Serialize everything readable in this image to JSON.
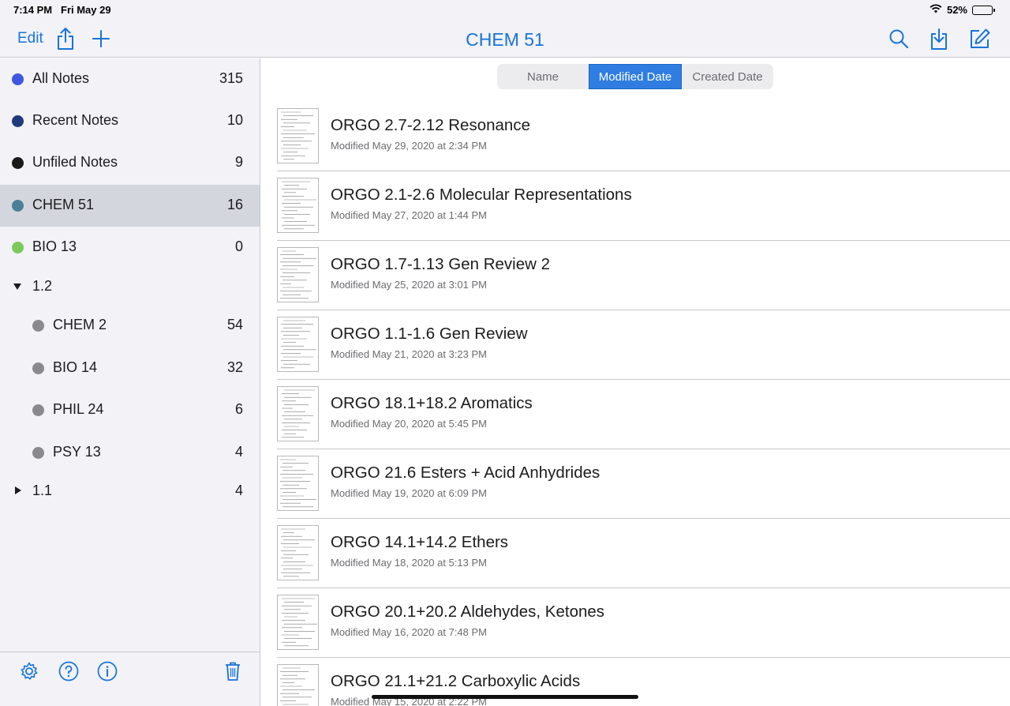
{
  "status": {
    "time": "7:14 PM",
    "date": "Fri May 29",
    "battery_pct": "52%",
    "battery_level": 0.52
  },
  "nav": {
    "edit_label": "Edit",
    "title": "CHEM 51"
  },
  "sidebar": {
    "items": [
      {
        "label": "All Notes",
        "count": "315",
        "color": "#3f56e0"
      },
      {
        "label": "Recent Notes",
        "count": "10",
        "color": "#1f3a7a"
      },
      {
        "label": "Unfiled Notes",
        "count": "9",
        "color": "#1a1a1a"
      },
      {
        "label": "CHEM 51",
        "count": "16",
        "color": "#4a7f95",
        "selected": true
      },
      {
        "label": "BIO 13",
        "count": "0",
        "color": "#7cc95c"
      },
      {
        "label": "1.2",
        "count": "",
        "expanded": true
      },
      {
        "label": "CHEM 2",
        "count": "54",
        "color": "#8a8a8e"
      },
      {
        "label": "BIO 14",
        "count": "32",
        "color": "#8a8a8e"
      },
      {
        "label": "PHIL 24",
        "count": "6",
        "color": "#8a8a8e"
      },
      {
        "label": "PSY 13",
        "count": "4",
        "color": "#8a8a8e"
      },
      {
        "label": "1.1",
        "count": "4",
        "expanded": false
      }
    ]
  },
  "sort": {
    "options": [
      "Name",
      "Modified Date",
      "Created Date"
    ],
    "selected": "Modified Date"
  },
  "notes": [
    {
      "title": "ORGO 2.7-2.12 Resonance",
      "modified": "Modified May 29, 2020 at 2:34 PM"
    },
    {
      "title": "ORGO 2.1-2.6 Molecular Representations",
      "modified": "Modified May 27, 2020 at 1:44 PM"
    },
    {
      "title": "ORGO 1.7-1.13 Gen Review 2",
      "modified": "Modified May 25, 2020 at 3:01 PM"
    },
    {
      "title": "ORGO 1.1-1.6 Gen Review",
      "modified": "Modified May 21, 2020 at 3:23 PM"
    },
    {
      "title": "ORGO 18.1+18.2 Aromatics",
      "modified": "Modified May 20, 2020 at 5:45 PM"
    },
    {
      "title": "ORGO 21.6 Esters + Acid Anhydrides",
      "modified": "Modified May 19, 2020 at 6:09 PM"
    },
    {
      "title": "ORGO 14.1+14.2 Ethers",
      "modified": "Modified May 18, 2020 at 5:13 PM"
    },
    {
      "title": "ORGO 20.1+20.2 Aldehydes, Ketones",
      "modified": "Modified May 16, 2020 at 7:48 PM"
    },
    {
      "title": "ORGO 21.1+21.2 Carboxylic Acids",
      "modified": "Modified May 15, 2020 at 2:22 PM"
    }
  ],
  "colors": {
    "accent": "#1a73d9",
    "segment_active": "#2f7de1",
    "sidebar_bg": "#f2f2f7",
    "selected_row": "#d4d6de"
  },
  "icons": [
    "share-icon",
    "plus-icon",
    "search-icon",
    "import-icon",
    "compose-icon",
    "settings-icon",
    "help-icon",
    "info-icon",
    "trash-icon"
  ]
}
